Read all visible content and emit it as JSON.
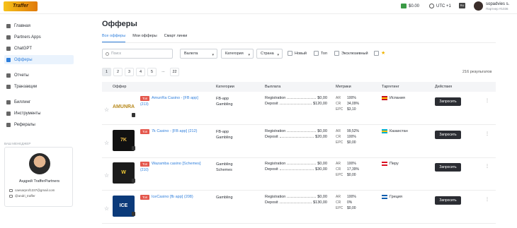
{
  "header": {
    "logo": "Traffer",
    "balance": "$0.00",
    "timezone": "UTC +1",
    "lang": "RU",
    "user_name": "sopadvies s.",
    "user_id": "Партнер #1036"
  },
  "sidebar": {
    "items": [
      {
        "label": "Главная",
        "icon": "home-icon"
      },
      {
        "label": "Partners Apps",
        "icon": "apps-icon"
      },
      {
        "label": "ChatGPT",
        "icon": "chat-icon"
      },
      {
        "label": "Офферы",
        "icon": "tag-icon"
      },
      {
        "label": "Отчеты",
        "icon": "chart-icon"
      },
      {
        "label": "Транзакции",
        "icon": "transfer-icon"
      },
      {
        "label": "Биллинг",
        "icon": "card-icon"
      },
      {
        "label": "Инструменты",
        "icon": "wrench-icon"
      },
      {
        "label": "Рефералы",
        "icon": "people-icon"
      }
    ],
    "manager_label": "ВАШ МЕНЕДЖЕР",
    "manager_name": "Андрей TrafferPartners",
    "manager_email": "caesarprof1337@gmail.com",
    "manager_tg": "@andri_traffer"
  },
  "main": {
    "title": "Офферы",
    "tabs": [
      "Все офферы",
      "Мои офферы",
      "Смарт линки"
    ],
    "search_placeholder": "Поиск",
    "filters": {
      "currency": "Валюта",
      "category": "Категория",
      "country": "Страна",
      "new": "Новый",
      "top": "Топ",
      "exclusive": "Эксклюзивный"
    },
    "pages": [
      "1",
      "2",
      "3",
      "4",
      "5",
      "...",
      "22"
    ],
    "results": "216 результатов",
    "columns": [
      "Оффер",
      "Категории",
      "Выплата",
      "Метрики",
      "Таргетинг",
      "Действия"
    ],
    "rows": [
      {
        "badge": "Топ",
        "name": "AmunRa Casino - [FB app]",
        "id": "(213)",
        "thumb_text": "AMUNRA",
        "thumb_bg": "#ffffff",
        "thumb_fg": "#b88a1e",
        "cat1": "FB-app",
        "cat2": "Gambling",
        "pay1_label": "Registration",
        "pay1_val": "$0,00",
        "pay2_label": "Deposit",
        "pay2_val": "$120,00",
        "ar": "100%",
        "cr": "34,09%",
        "epc": "$3,10",
        "geo": "Испания",
        "flag_colors": [
          "#c60b1e",
          "#ffc400"
        ],
        "action": "Запросить"
      },
      {
        "badge": "Топ",
        "name": "7k Casino - [FB app] (212)",
        "id": "",
        "thumb_text": "7K",
        "thumb_bg": "#111111",
        "thumb_fg": "#f2c14a",
        "cat1": "FB-app",
        "cat2": "Gambling",
        "pay1_label": "Registration",
        "pay1_val": "$0,00",
        "pay2_label": "Deposit",
        "pay2_val": "$20,00",
        "ar": "99,52%",
        "cr": "100%",
        "epc": "$0,00",
        "geo": "Казахстан",
        "flag_colors": [
          "#00afca",
          "#fec50c"
        ],
        "action": "Запросить"
      },
      {
        "badge": "Топ",
        "name": "Wazamba casino [Schemes]",
        "id": "(210)",
        "thumb_text": "W",
        "thumb_bg": "#1c1c1c",
        "thumb_fg": "#f4cd36",
        "cat1": "Gambling",
        "cat2": "Schemes",
        "pay1_label": "Registration",
        "pay1_val": "$0,00",
        "pay2_label": "Deposit",
        "pay2_val": "$30,00",
        "ar": "100%",
        "cr": "17,39%",
        "epc": "$0,00",
        "geo": "Перу",
        "flag_colors": [
          "#d91023",
          "#ffffff"
        ],
        "action": "Запросить"
      },
      {
        "badge": "Топ",
        "name": "IceCasino [fb app] (208)",
        "id": "",
        "thumb_text": "ICE",
        "thumb_bg": "#0b3a7a",
        "thumb_fg": "#ffffff",
        "cat1": "Gambling",
        "cat2": "",
        "pay1_label": "Registration",
        "pay1_val": "$0,00",
        "pay2_label": "Deposit",
        "pay2_val": "$130,00",
        "ar": "100%",
        "cr": "0%",
        "epc": "$0,00",
        "geo": "Греция",
        "flag_colors": [
          "#0d5eaf",
          "#ffffff"
        ],
        "action": "Запросить"
      }
    ]
  }
}
